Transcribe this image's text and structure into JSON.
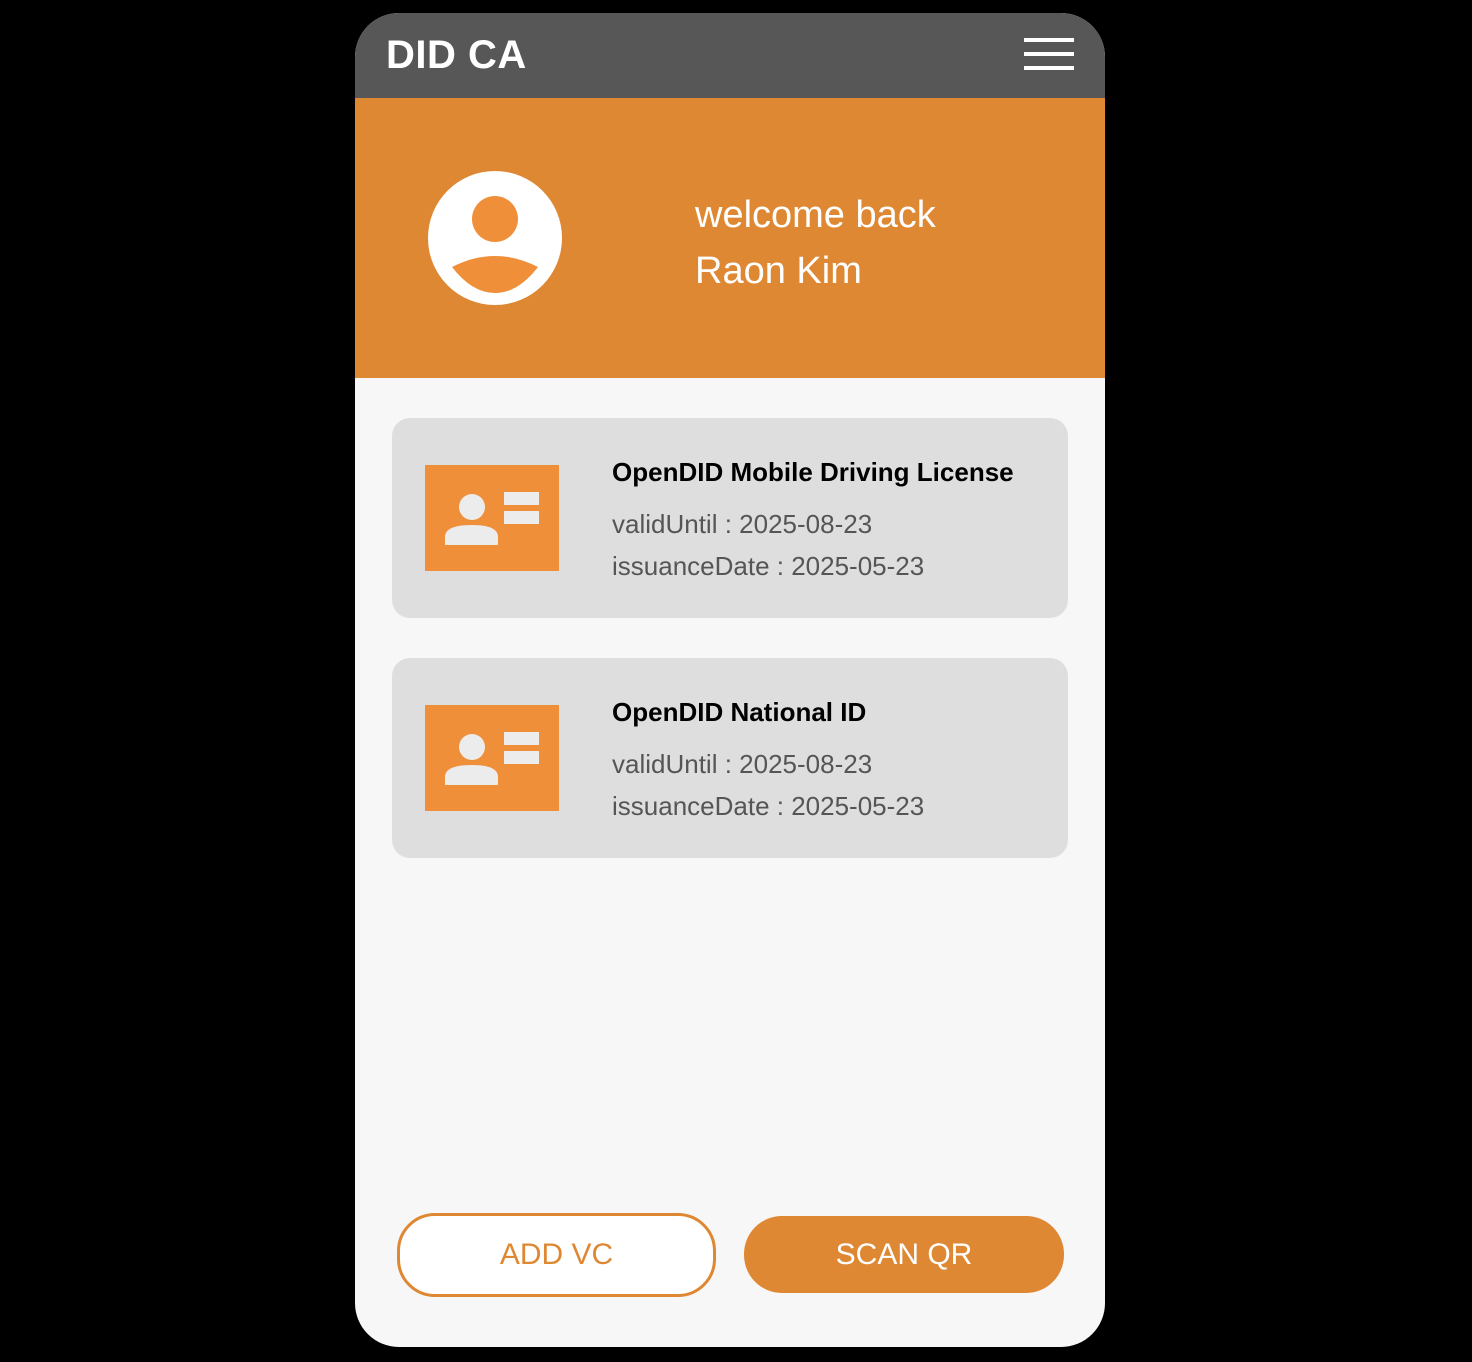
{
  "header": {
    "title": "DID CA",
    "menu_icon": "hamburger-menu-icon",
    "background_color": "#575757"
  },
  "hero": {
    "greeting": "welcome back",
    "user_name": "Raon Kim",
    "avatar_icon": "user-avatar-icon",
    "background_color": "#df8833"
  },
  "credentials": [
    {
      "title": "OpenDID Mobile Driving License",
      "valid_until": "validUntil : 2025-08-23",
      "issuance_date": "issuanceDate : 2025-05-23",
      "icon": "id-card-icon"
    },
    {
      "title": "OpenDID National ID",
      "valid_until": "validUntil : 2025-08-23",
      "issuance_date": "issuanceDate : 2025-05-23",
      "icon": "id-card-icon"
    }
  ],
  "actions": {
    "add_vc_label": "ADD VC",
    "scan_qr_label": "SCAN QR"
  },
  "colors": {
    "accent": "#df8833",
    "card_icon": "#ef8f3a",
    "card_background": "#dedede",
    "page_background": "#f7f7f7"
  }
}
